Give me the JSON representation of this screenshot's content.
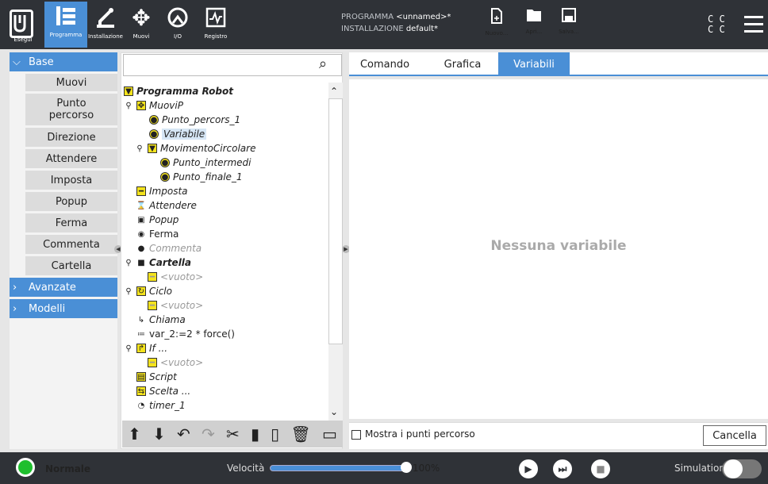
{
  "header": {
    "nav": [
      {
        "label": "Esegui",
        "icon": "robot-arm-run-icon"
      },
      {
        "label": "Programma",
        "icon": "program-tree-icon",
        "active": true
      },
      {
        "label": "Installazione",
        "icon": "robot-installation-icon"
      },
      {
        "label": "Muovi",
        "icon": "move-arrows-icon"
      },
      {
        "label": "I/O",
        "icon": "io-icon"
      },
      {
        "label": "Registro",
        "icon": "log-chart-icon"
      }
    ],
    "program_label": "PROGRAMMA",
    "program_value": "<unnamed>*",
    "installation_label": "INSTALLAZIONE",
    "installation_value": "default*",
    "file": {
      "new": "Nuovo...",
      "open": "Apri...",
      "save": "Salva..."
    },
    "cc": [
      "C C",
      "C C"
    ]
  },
  "sidebar": {
    "base_label": "Base",
    "base_items": [
      "Muovi",
      "Punto percorso",
      "Direzione",
      "Attendere",
      "Imposta",
      "Popup",
      "Ferma",
      "Commenta",
      "Cartella"
    ],
    "advanced_label": "Avanzate",
    "templates_label": "Modelli"
  },
  "tree": {
    "root": "Programma Robot",
    "nodes": [
      {
        "text": "MuoviP"
      },
      {
        "text": "Punto_percors_1"
      },
      {
        "text": "Variabile"
      },
      {
        "text": "MovimentoCircolare"
      },
      {
        "text": "Punto_intermedi"
      },
      {
        "text": "Punto_finale_1"
      },
      {
        "text": "Imposta"
      },
      {
        "text": "Attendere"
      },
      {
        "text": "Popup"
      },
      {
        "text": "Ferma"
      },
      {
        "text": "Commenta"
      },
      {
        "text": "Cartella"
      },
      {
        "text": "<vuoto>"
      },
      {
        "text": "Ciclo"
      },
      {
        "text": "<vuoto>"
      },
      {
        "text": "Chiama"
      },
      {
        "text": "var_2:=2 * force()"
      },
      {
        "text": "If ..."
      },
      {
        "text": "<vuoto>"
      },
      {
        "text": "Script"
      },
      {
        "text": "Scelta ..."
      },
      {
        "text": "timer_1"
      }
    ]
  },
  "tabs": [
    "Comando",
    "Grafica",
    "Variabili"
  ],
  "content": {
    "empty_message": "Nessuna variabile",
    "show_waypoints_label": "Mostra i punti percorso",
    "cancel_label": "Cancella"
  },
  "footer": {
    "status": "Normale",
    "speed_label": "Velocità",
    "speed_value": "100%",
    "speed_fraction": 1.0,
    "simulation_label": "Simulation"
  },
  "colors": {
    "accent": "#4a8fd6",
    "header": "#2f3237",
    "status_ok": "#1fbf2e",
    "node_yellow": "#f4e31c"
  }
}
